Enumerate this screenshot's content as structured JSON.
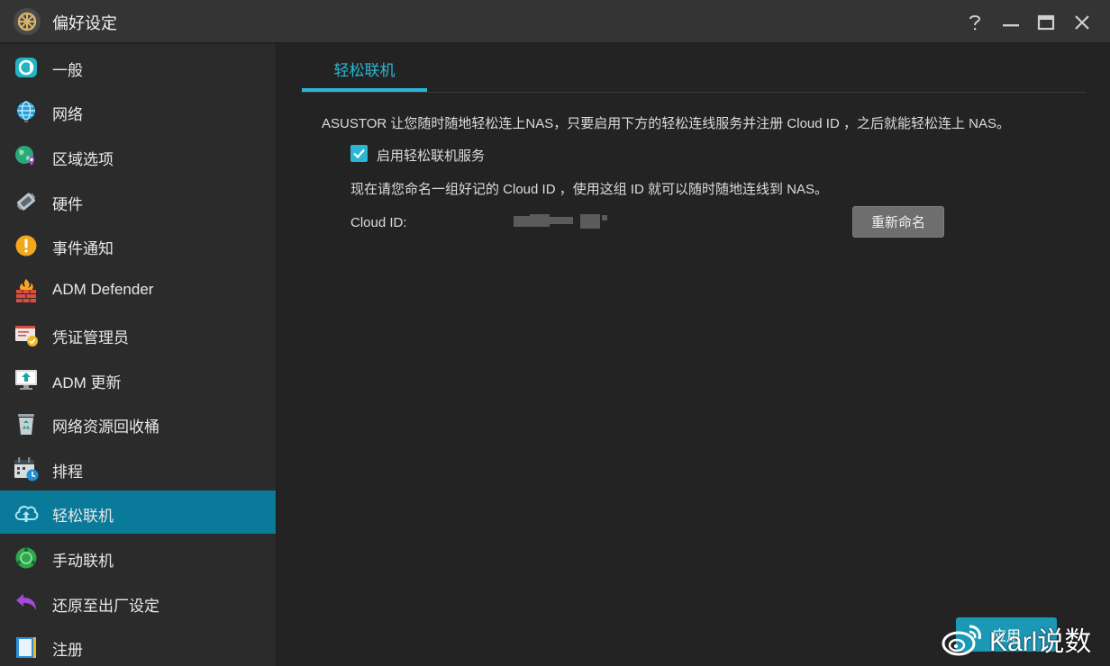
{
  "window": {
    "title": "偏好设定"
  },
  "sidebar": {
    "items": [
      {
        "label": "一般",
        "icon": "general-icon"
      },
      {
        "label": "网络",
        "icon": "network-globe-icon"
      },
      {
        "label": "区域选项",
        "icon": "region-globe-icon"
      },
      {
        "label": "硬件",
        "icon": "hardware-icon"
      },
      {
        "label": "事件通知",
        "icon": "alert-icon"
      },
      {
        "label": "ADM Defender",
        "icon": "firewall-icon"
      },
      {
        "label": "凭证管理员",
        "icon": "certificate-icon"
      },
      {
        "label": "ADM 更新",
        "icon": "update-icon"
      },
      {
        "label": "网络资源回收桶",
        "icon": "recycle-bin-icon"
      },
      {
        "label": "排程",
        "icon": "schedule-icon"
      },
      {
        "label": "轻松联机",
        "icon": "cloud-connect-icon",
        "active": true
      },
      {
        "label": "手动联机",
        "icon": "manual-connect-icon"
      },
      {
        "label": "还原至出厂设定",
        "icon": "restore-icon"
      },
      {
        "label": "注册",
        "icon": "register-icon"
      }
    ]
  },
  "main": {
    "tab_label": "轻松联机",
    "intro": "ASUSTOR 让您随时随地轻松连上NAS，只要启用下方的轻松连线服务并注册 Cloud ID ，之后就能轻松连上 NAS。",
    "enable_label": "启用轻松联机服务",
    "enable_checked": true,
    "hint": "现在请您命名一组好记的 Cloud ID ，使用这组 ID 就可以随时随地连线到 NAS。",
    "cloud_id_label": "Cloud ID:",
    "rename_label": "重新命名",
    "apply_label": "应用"
  },
  "watermark": {
    "text": "Karl说数"
  },
  "colors": {
    "accent": "#2bb6d6",
    "active_item": "#0a7a9a",
    "apply_button": "#1b98b6"
  }
}
